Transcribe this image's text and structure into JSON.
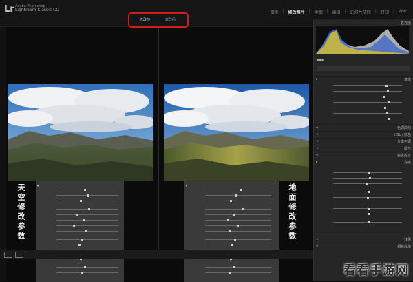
{
  "app": {
    "logo": "Lr",
    "brand_line1": "Adobe Photoshop",
    "brand_line2": "Lightroom Classic CC"
  },
  "modules": [
    "图库",
    "修改照片",
    "地图",
    "画册",
    "幻灯片放映",
    "打印",
    "Web"
  ],
  "compare": {
    "before_label": "修改前",
    "after_label": "修改后"
  },
  "left_note": [
    "天",
    "空",
    "修",
    "改",
    "参",
    "数"
  ],
  "right_note": [
    "地",
    "面",
    "修",
    "改",
    "参",
    "数"
  ],
  "right_panel": {
    "histogram_label": "直方图",
    "basic_label": "基本",
    "tone_curve_label": "色调曲线",
    "hsl_label": "HSL / 颜色",
    "split_toning_label": "分离色调",
    "detail_label": "细节",
    "lens_label": "镜头校正",
    "transform_label": "变换",
    "effects_label": "效果",
    "calibration_label": "相机校准"
  },
  "watermark": "看看手游网"
}
